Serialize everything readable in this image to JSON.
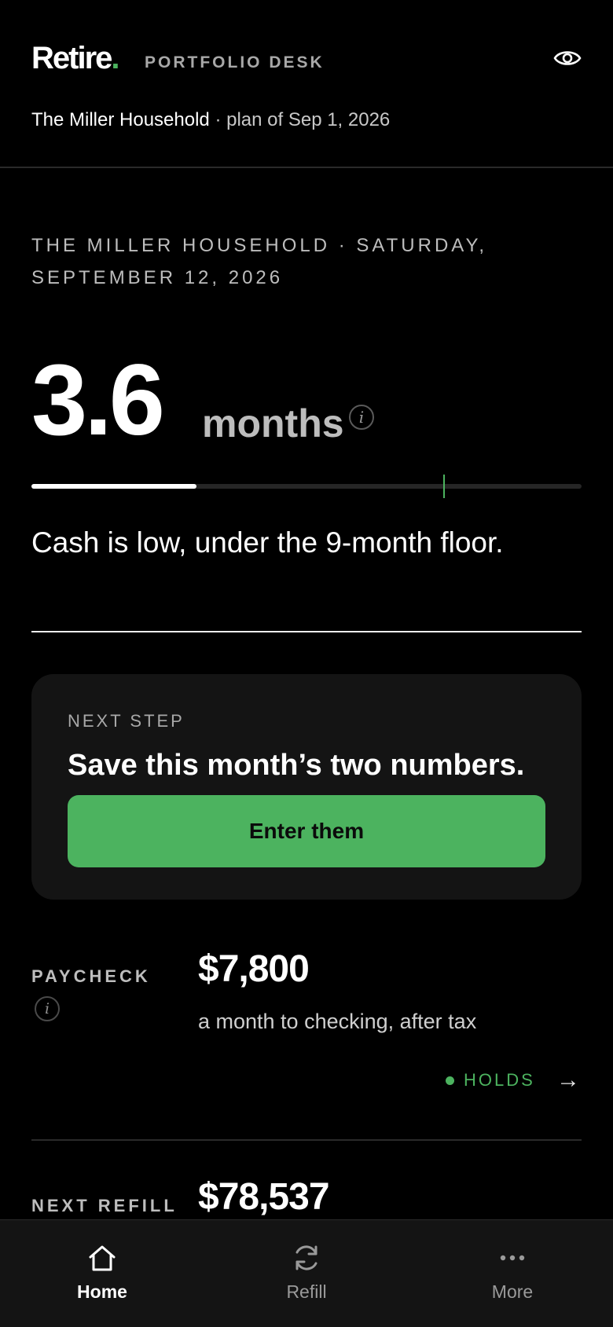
{
  "header": {
    "brand": "Retire",
    "brand_dot": ".",
    "section": "PORTFOLIO DESK",
    "household": "The Miller Household",
    "plan_date": " · plan of Sep 1, 2026"
  },
  "summary": {
    "kicker": "THE MILLER HOUSEHOLD · SATURDAY, SEPTEMBER 12, 2026",
    "months_value": "3.6",
    "months_unit": "months",
    "info_glyph": "i",
    "runway_fraction": 0.3,
    "floor_fraction": 0.75,
    "status": "Cash is low, under the 9-month floor."
  },
  "next_step": {
    "kicker": "NEXT STEP",
    "title": "Save this month’s two numbers.",
    "cta": "Enter them"
  },
  "paycheck": {
    "label": "PAYCHECK",
    "info_glyph": "i",
    "value": "$7,800",
    "subtitle": "a month to checking, after tax",
    "status": "HOLDS",
    "arrow": "→"
  },
  "next_refill": {
    "label": "NEXT REFILL",
    "value": "$78,537"
  },
  "nav": {
    "home": "Home",
    "refill": "Refill",
    "more": "More"
  },
  "colors": {
    "accent": "#4cb35f",
    "background": "#000000",
    "card": "#141414"
  },
  "icons": {
    "visibility": "eye-icon",
    "home": "home-icon",
    "refill": "refresh-icon",
    "more": "more-dots-icon"
  }
}
